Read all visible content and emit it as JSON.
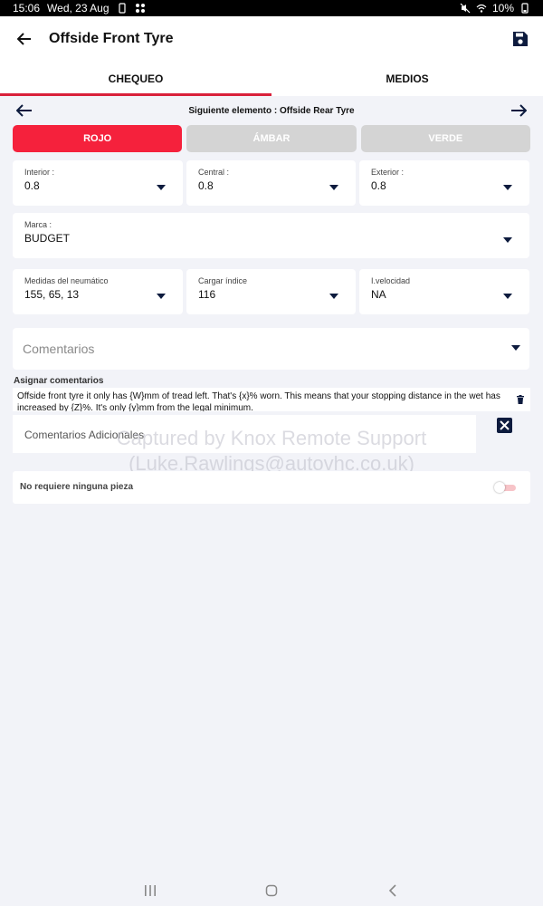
{
  "status_bar": {
    "time": "15:06",
    "date": "Wed, 23 Aug",
    "battery": "10%"
  },
  "header": {
    "title": "Offside Front Tyre"
  },
  "tabs": [
    {
      "label": "CHEQUEO",
      "active": true
    },
    {
      "label": "MEDIOS",
      "active": false
    }
  ],
  "next_element": {
    "label": "Siguiente elemento : Offside Rear Tyre"
  },
  "rag": {
    "red": "ROJO",
    "amber": "ÁMBAR",
    "green": "VERDE",
    "selected": "red"
  },
  "tread": {
    "inner": {
      "label": "Interior :",
      "value": "0.8"
    },
    "center": {
      "label": "Central :",
      "value": "0.8"
    },
    "outer": {
      "label": "Exterior :",
      "value": "0.8"
    }
  },
  "brand": {
    "label": "Marca :",
    "value": "BUDGET"
  },
  "specs": {
    "size": {
      "label": "Medidas del neumático",
      "value": "155, 65, 13"
    },
    "load": {
      "label": "Cargar índice",
      "value": "116"
    },
    "speed": {
      "label": "I.velocidad",
      "value": "NA"
    }
  },
  "comments": {
    "placeholder": "Comentarios"
  },
  "assign": {
    "label": "Asignar comentarios",
    "text": "Offside front tyre it only has {W}mm of tread left.  That's {x}% worn.  This means that your stopping distance in the wet has increased by {Z}%.  It's only {y}mm from the legal minimum."
  },
  "additional": {
    "placeholder": "Comentarios Adicionales"
  },
  "watermark": {
    "line1": "Captured by Knox Remote Support",
    "line2": "(Luke.Rawlings@autovhc.co.uk)"
  },
  "no_parts": {
    "label": "No requiere ninguna pieza",
    "enabled": false
  },
  "colors": {
    "accent": "#f5213c",
    "tab_indicator": "#d9203a",
    "navy": "#0d1b3e",
    "inactive": "#d4d4d4"
  }
}
